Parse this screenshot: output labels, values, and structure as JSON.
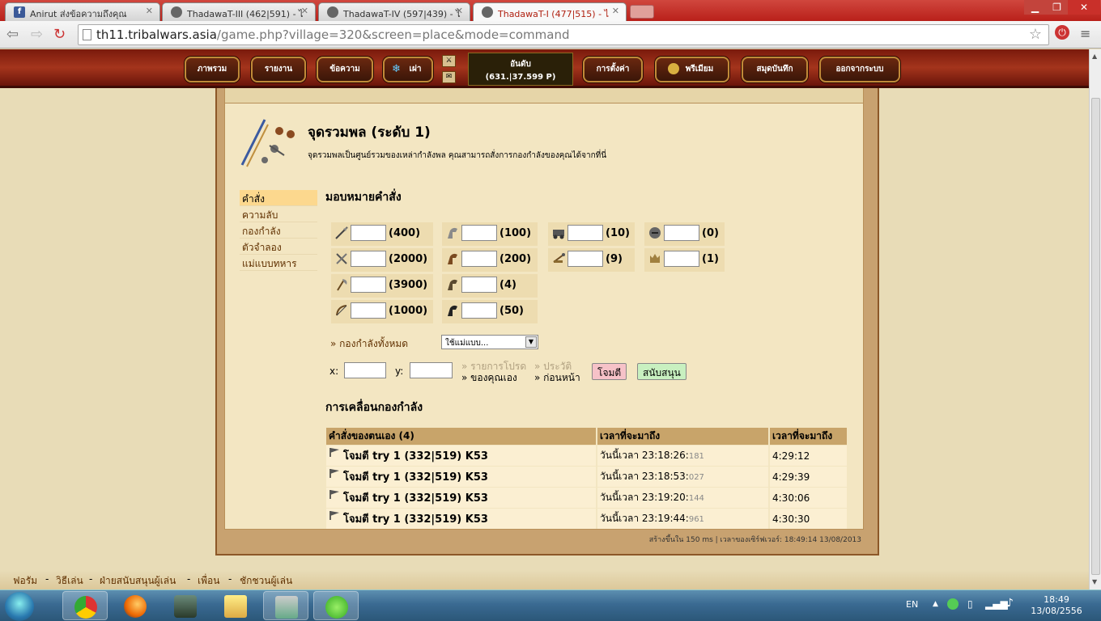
{
  "browser": {
    "tabs": [
      {
        "label": "Anirut ส่งข้อความถึงคุณ",
        "icon": "facebook-icon"
      },
      {
        "label": "ThadawaT-III (462|591) - ไ",
        "icon": "tribalwars-icon"
      },
      {
        "label": "ThadawaT-IV (597|439) - ไ",
        "icon": "tribalwars-icon"
      },
      {
        "label": "ThadawaT-I (477|515) - ไ",
        "icon": "tribalwars-icon",
        "active": true
      }
    ],
    "url_host": "th11.tribalwars.asia",
    "url_path": "/game.php?village=320&screen=place&mode=command"
  },
  "topmenu": {
    "map": "ภาพรวม",
    "reports": "รายงาน",
    "messages": "ข้อความ",
    "tribe": "เผ่า",
    "rank_label": "อันดับ",
    "rank_value": "(631.|37.599 P)",
    "settings": "การตั้งค่า",
    "premium": "พรีเมียม",
    "notebook": "สมุดบันทึก",
    "logout": "ออกจากระบบ"
  },
  "page": {
    "title": "จุดรวมพล (ระดับ 1)",
    "description": "จุดรวมพลเป็นศูนย์รวมของเหล่ากำลังพล คุณสามารถสั่งการกองกำลังของคุณได้จากที่นี่",
    "subtitle": "มอบหมายคำสั่ง",
    "movements_title": "การเคลื่อนกองกำลัง"
  },
  "sidemenu": [
    "คำสั่ง",
    "ความลับ",
    "กองกำลัง",
    "ตัวจำลอง",
    "แม่แบบทหาร"
  ],
  "units": {
    "spear": "(400)",
    "sword": "(2000)",
    "axe": "(3900)",
    "archer": "(1000)",
    "spy": "(100)",
    "light": "(200)",
    "marcher": "(4)",
    "heavy": "(50)",
    "ram": "(10)",
    "catapult": "(9)",
    "knight": "(0)",
    "snob": "(1)"
  },
  "form": {
    "all_troops": "» กองกำลังทั้งหมด",
    "template_select": "ใช้แม่แบบ...",
    "x_label": "x:",
    "y_label": "y:",
    "own_list_1": "» รายการโปรด",
    "own_list_2": "» ของคุณเอง",
    "history_1": "» ประวัติ",
    "history_2": "» ก่อนหน้า",
    "attack_btn": "โจมตี",
    "support_btn": "สนับสนุน",
    "attack_color": "#f6c2c8",
    "support_color": "#c8f0c0"
  },
  "commands": {
    "headers": [
      "คำสั่งของตนเอง (4)",
      "เวลาที่จะมาถึง",
      "เวลาที่จะมาถึง"
    ],
    "rows": [
      {
        "name": "โจมตี try 1 (332|519) K53",
        "arrival": "วันนี้เวลา 23:18:26:",
        "ms": "181",
        "remaining": "4:29:12"
      },
      {
        "name": "โจมตี try 1 (332|519) K53",
        "arrival": "วันนี้เวลา 23:18:53:",
        "ms": "027",
        "remaining": "4:29:39"
      },
      {
        "name": "โจมตี try 1 (332|519) K53",
        "arrival": "วันนี้เวลา 23:19:20:",
        "ms": "144",
        "remaining": "4:30:06"
      },
      {
        "name": "โจมตี try 1 (332|519) K53",
        "arrival": "วันนี้เวลา 23:19:44:",
        "ms": "961",
        "remaining": "4:30:30"
      }
    ]
  },
  "server_info": "สร้างขึ้นใน 150 ms | เวลาของเซิร์ฟเวอร์: 18:49:14 13/08/2013",
  "footer": [
    "ฟอรัม",
    "วิธีเล่น",
    "ฝ่ายสนับสนุนผู้เล่น",
    "เพื่อน",
    "ชักชวนผู้เล่น"
  ],
  "taskbar": {
    "lang": "EN",
    "time": "18:49",
    "date": "13/08/2556"
  }
}
